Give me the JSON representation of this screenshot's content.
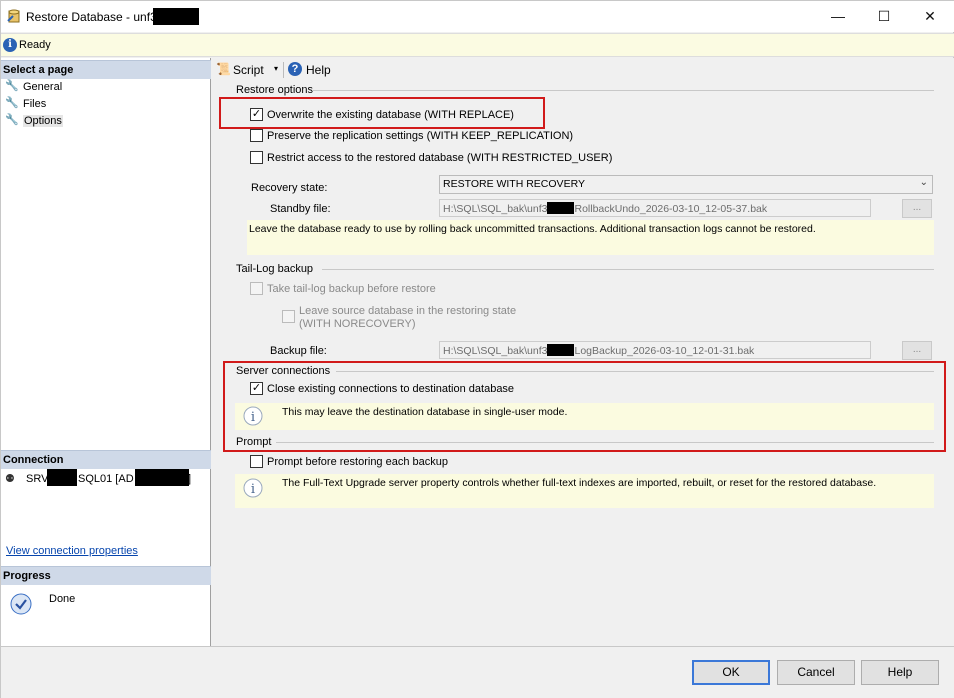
{
  "window": {
    "title": "Restore Database - unf3",
    "minimize": "—",
    "maximize": "☐",
    "close": "✕"
  },
  "status": {
    "text": "Ready"
  },
  "sidebar": {
    "select_page_header": "Select a page",
    "pages": [
      {
        "label": "General"
      },
      {
        "label": "Files"
      },
      {
        "label": "Options"
      }
    ],
    "connection_header": "Connection",
    "connection_text_1": "SRV",
    "connection_text_2": "SQL01 [AD",
    "connection_text_3": "]",
    "view_connection_link": "View connection properties",
    "progress_header": "Progress",
    "progress_status": "Done"
  },
  "toolbar": {
    "script_label": "Script",
    "help_label": "Help"
  },
  "restore_options": {
    "header": "Restore options",
    "overwrite": {
      "label": "Overwrite the existing database (WITH REPLACE)",
      "checked": true
    },
    "preserve": {
      "label": "Preserve the replication settings (WITH KEEP_REPLICATION)",
      "checked": false
    },
    "restrict": {
      "label": "Restrict access to the restored database (WITH RESTRICTED_USER)",
      "checked": false
    },
    "recovery_state_label": "Recovery state:",
    "recovery_state_value": "RESTORE WITH RECOVERY",
    "standby_label": "Standby file:",
    "standby_prefix": "H:\\SQL\\SQL_bak\\unf3",
    "standby_suffix": "RollbackUndo_2026-03-10_12-05-37.bak",
    "browse": "...",
    "recovery_note": "Leave the database ready to use by rolling back uncommitted transactions. Additional transaction logs cannot be restored."
  },
  "tail_log": {
    "header": "Tail-Log backup",
    "take_label": "Take tail-log backup before restore",
    "leave_label_1": "Leave source database in the restoring state",
    "leave_label_2": "(WITH NORECOVERY)",
    "backup_file_label": "Backup file:",
    "backup_prefix": "H:\\SQL\\SQL_bak\\unf3",
    "backup_suffix": "LogBackup_2026-03-10_12-01-31.bak",
    "browse": "..."
  },
  "server_connections": {
    "header": "Server connections",
    "close_label": "Close existing connections to destination database",
    "close_checked": true,
    "note": "This may leave the destination database in single-user mode."
  },
  "prompt": {
    "header": "Prompt",
    "prompt_label": "Prompt before restoring each backup",
    "note": "The Full-Text Upgrade server property controls whether full-text indexes are imported, rebuilt, or reset for the restored database."
  },
  "buttons": {
    "ok": "OK",
    "cancel": "Cancel",
    "help": "Help"
  },
  "colors": {
    "highlight_box": "#d11a1a",
    "note_bg": "#fbfbe0",
    "status_bg": "#fbfbe2",
    "link": "#0645ad"
  }
}
